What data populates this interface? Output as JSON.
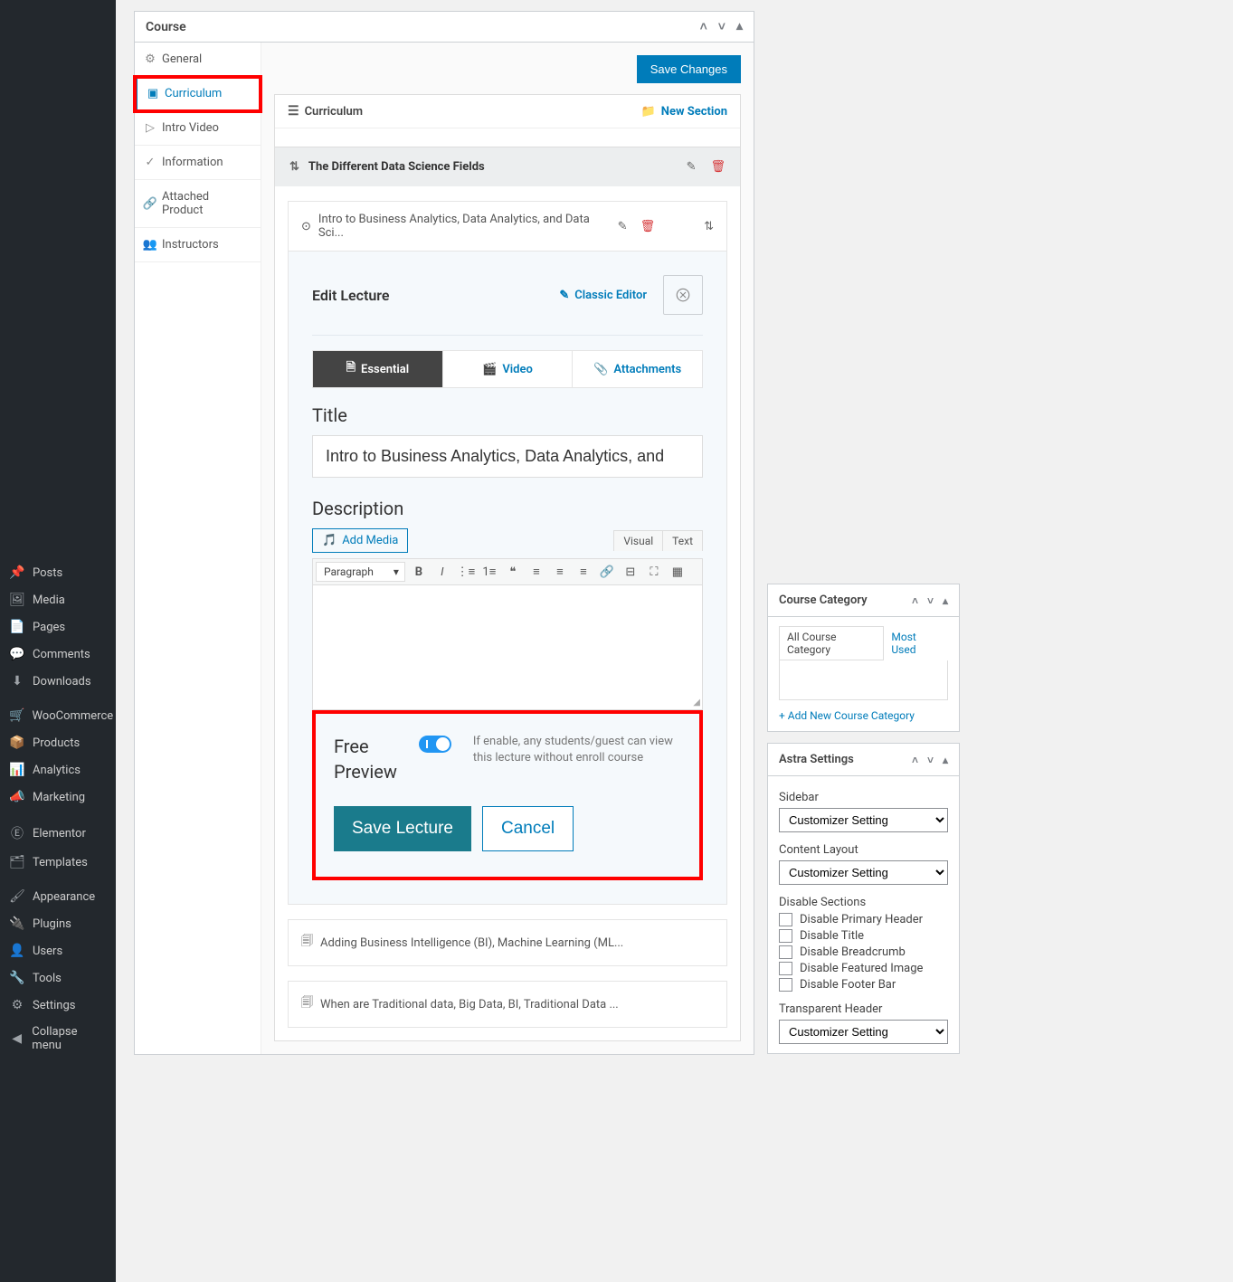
{
  "sidebar": {
    "items": [
      {
        "icon": "📌",
        "label": "Posts"
      },
      {
        "icon": "🖼",
        "label": "Media"
      },
      {
        "icon": "📄",
        "label": "Pages"
      },
      {
        "icon": "💬",
        "label": "Comments"
      },
      {
        "icon": "⬇",
        "label": "Downloads"
      },
      {
        "icon": "🛒",
        "label": "WooCommerce"
      },
      {
        "icon": "📦",
        "label": "Products"
      },
      {
        "icon": "📊",
        "label": "Analytics"
      },
      {
        "icon": "📣",
        "label": "Marketing"
      },
      {
        "icon": "Ⓔ",
        "label": "Elementor"
      },
      {
        "icon": "🗂",
        "label": "Templates"
      },
      {
        "icon": "🖌",
        "label": "Appearance"
      },
      {
        "icon": "🔌",
        "label": "Plugins"
      },
      {
        "icon": "👤",
        "label": "Users"
      },
      {
        "icon": "🔧",
        "label": "Tools"
      },
      {
        "icon": "⚙",
        "label": "Settings"
      },
      {
        "icon": "◀",
        "label": "Collapse menu"
      }
    ]
  },
  "metabox": {
    "title": "Course"
  },
  "tabs": [
    {
      "icon": "⚙",
      "label": "General"
    },
    {
      "icon": "▣",
      "label": "Curriculum"
    },
    {
      "icon": "▷",
      "label": "Intro Video"
    },
    {
      "icon": "✓",
      "label": "Information"
    },
    {
      "icon": "🔗",
      "label": "Attached Product"
    },
    {
      "icon": "👥",
      "label": "Instructors"
    }
  ],
  "toolbar": {
    "save_changes": "Save Changes"
  },
  "curriculum": {
    "title": "Curriculum",
    "new_section": "New Section",
    "section_title": "The Different Data Science Fields",
    "lecture_title_short": "Intro to Business Analytics, Data Analytics, and Data Sci...",
    "edit_lecture": "Edit Lecture",
    "classic_editor": "Classic Editor",
    "subtabs": {
      "essential": "Essential",
      "video": "Video",
      "attachments": "Attachments"
    },
    "title_label": "Title",
    "title_value": "Intro to Business Analytics, Data Analytics, and",
    "desc_label": "Description",
    "add_media": "Add Media",
    "modes": {
      "visual": "Visual",
      "text": "Text"
    },
    "paragraph": "Paragraph",
    "free_preview_label": "Free Preview",
    "free_preview_help": "If enable, any students/guest can view this lecture without enroll course",
    "save_lecture": "Save Lecture",
    "cancel": "Cancel",
    "bottom_items": [
      "Adding Business Intelligence (BI), Machine Learning (ML...",
      "When are Traditional data, Big Data, BI, Traditional Data ..."
    ]
  },
  "right": {
    "cat_title": "Course Category",
    "all_cat": "All Course Category",
    "most_used": "Most Used",
    "add_new_cat": "+ Add New Course Category",
    "astra_title": "Astra Settings",
    "sidebar_lbl": "Sidebar",
    "customizer": "Customizer Setting",
    "content_layout": "Content Layout",
    "disable_sections": "Disable Sections",
    "disable_opts": [
      "Disable Primary Header",
      "Disable Title",
      "Disable Breadcrumb",
      "Disable Featured Image",
      "Disable Footer Bar"
    ],
    "transparent_header": "Transparent Header"
  }
}
